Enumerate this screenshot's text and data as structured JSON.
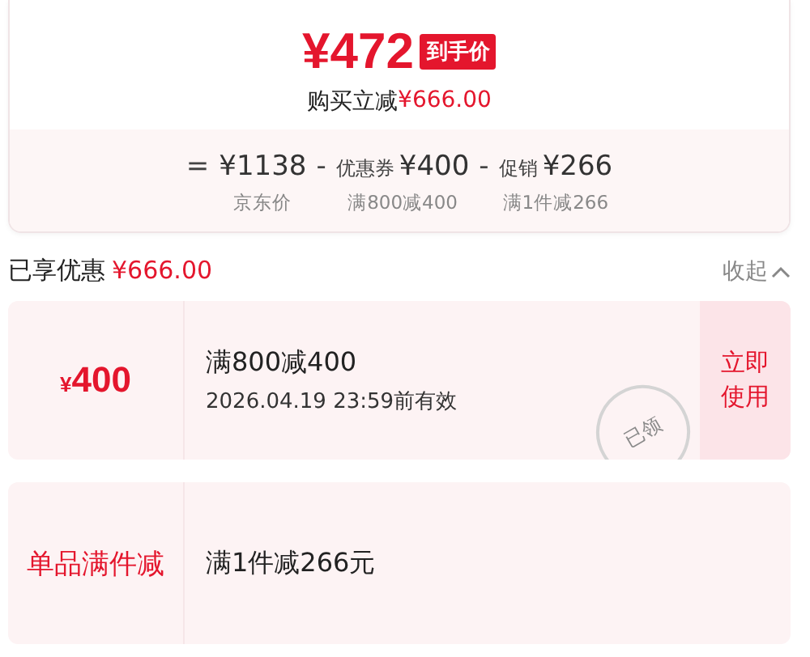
{
  "summary": {
    "price": "¥472",
    "price_badge": "到手价",
    "saving_label": "购买立减",
    "saving_amount": "¥666.00",
    "formula": [
      {
        "kind": "op",
        "text": "="
      },
      {
        "kind": "term",
        "value": "¥1138",
        "note": "京东价"
      },
      {
        "kind": "op",
        "text": "-"
      },
      {
        "kind": "term",
        "name": "优惠券",
        "value": "¥400",
        "note": "满800减400"
      },
      {
        "kind": "op",
        "text": "-"
      },
      {
        "kind": "term",
        "name": "促销",
        "value": "¥266",
        "note": "满1件减266"
      }
    ]
  },
  "discounts_header": {
    "label": "已享优惠",
    "amount": "¥666.00",
    "toggle": "收起",
    "expanded": true
  },
  "offers": [
    {
      "kind": "coupon",
      "currency": "¥",
      "amount": "400",
      "title": "满800减400",
      "validity": "2026.04.19 23:59前有效",
      "stamp": "已领",
      "action": "立即使用"
    },
    {
      "kind": "promo",
      "label": "单品满件减",
      "title": "满1件减266元"
    }
  ]
}
